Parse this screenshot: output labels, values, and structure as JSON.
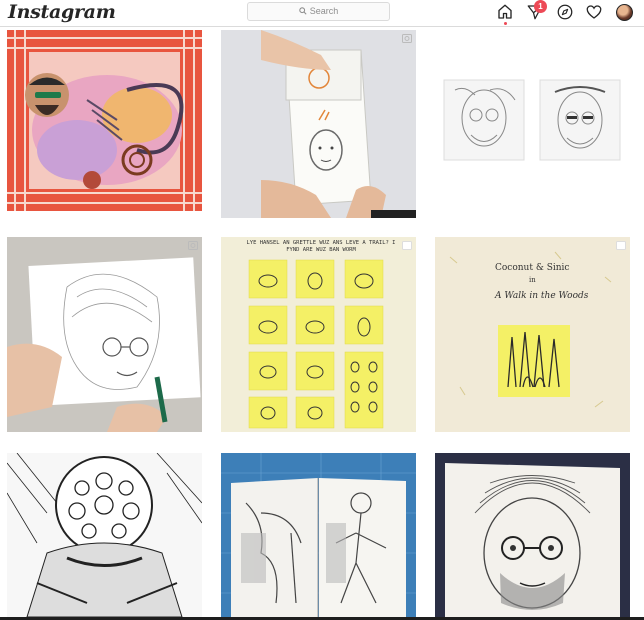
{
  "header": {
    "logo_text": "Instagram",
    "search_placeholder": "Search",
    "activity_badge": "1"
  },
  "icons": {
    "home": "home-icon",
    "direct": "paper-plane-icon",
    "explore": "compass-icon",
    "activity": "heart-icon",
    "profile": "avatar"
  },
  "posts": {
    "post5_heading": "LYE HANSEL AN GRETTLE WUZ ANS LEVE A TRAIL? I FYND ARE WUZ BAN WORM",
    "post6_title": "Coconut & Sinic",
    "post6_in": "in",
    "post6_subtitle": "A Walk in the Woods"
  },
  "colors": {
    "badge": "#ed4956",
    "border": "#dbdbdb",
    "sticky_note": "#f4f066"
  }
}
